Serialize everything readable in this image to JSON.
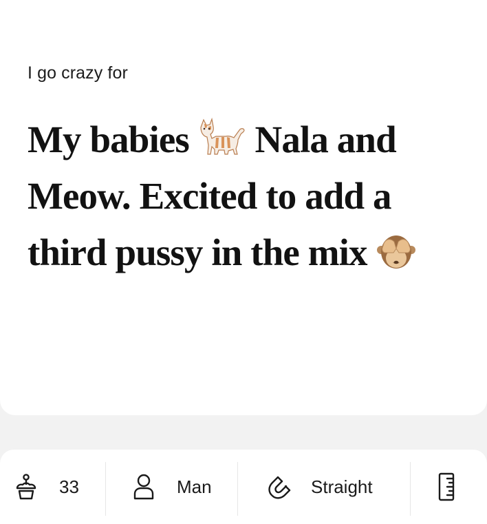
{
  "prompt": {
    "question": "I go crazy for",
    "answer_part1": "My babies ",
    "answer_part2": " Nala and Meow. Excited to add a third pussy in the mix ",
    "emoji_1": "cat-emoji",
    "emoji_2": "see-no-evil-monkey-emoji"
  },
  "vitals": {
    "age": {
      "icon": "cake-icon",
      "value": "33"
    },
    "gender": {
      "icon": "person-icon",
      "value": "Man"
    },
    "sexuality": {
      "icon": "magnet-icon",
      "value": "Straight"
    },
    "height": {
      "icon": "ruler-icon"
    }
  },
  "colors": {
    "page_background": "#f2f2f2",
    "card_background": "#ffffff",
    "text": "#121212",
    "divider": "#e6e6e6"
  }
}
